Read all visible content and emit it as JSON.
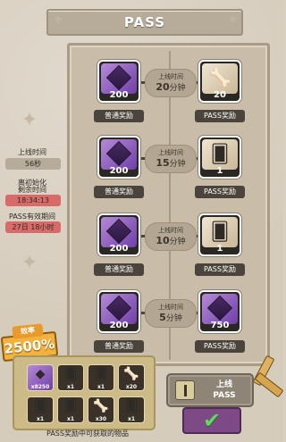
{
  "header": {
    "title": "PASS"
  },
  "rows": [
    {
      "left": {
        "amount": "200",
        "label": "普通奖励"
      },
      "time_top": "上线时间",
      "time_num": "20",
      "time_unit": "分钟",
      "right": {
        "amount": "20",
        "label": "PASS奖励",
        "icon": "bone-key-icon"
      }
    },
    {
      "left": {
        "amount": "200",
        "label": "普通奖励"
      },
      "time_top": "上线时间",
      "time_num": "15",
      "time_unit": "分钟",
      "right": {
        "amount": "1",
        "label": "PASS奖励",
        "icon": "card-icon"
      }
    },
    {
      "left": {
        "amount": "200",
        "label": "普通奖励"
      },
      "time_top": "上线时间",
      "time_num": "10",
      "time_unit": "分钟",
      "right": {
        "amount": "1",
        "label": "PASS奖励",
        "icon": "card-icon"
      }
    },
    {
      "left": {
        "amount": "200",
        "label": "普通奖励"
      },
      "time_top": "上线时间",
      "time_num": "5",
      "time_unit": "分钟",
      "right": {
        "amount": "750",
        "label": "PASS奖励",
        "icon": "purple-gem-icon"
      }
    }
  ],
  "info": {
    "online_label": "上线时间",
    "online_value": "56秒",
    "reset_label_1": "离初始化",
    "reset_label_2": "剩余时间",
    "reset_value": "18:34:13",
    "valid_label": "PASS有效期间",
    "valid_value": "27日 18小时"
  },
  "efficiency": {
    "label": "效率",
    "value": "2500%"
  },
  "tray": {
    "items": [
      {
        "amount": "x8250",
        "icon": "purple-gem-icon"
      },
      {
        "amount": "x1",
        "icon": "card-icon"
      },
      {
        "amount": "x1",
        "icon": "card-icon"
      },
      {
        "amount": "x20",
        "icon": "bone-key-icon"
      },
      {
        "amount": "x1",
        "icon": "card-icon"
      },
      {
        "amount": "x1",
        "icon": "card-icon"
      },
      {
        "amount": "x30",
        "icon": "bone-key-icon"
      },
      {
        "amount": "x1",
        "icon": "card-icon"
      }
    ],
    "caption": "PASS奖励中可获取的物品"
  },
  "claim": {
    "line1": "上线",
    "line2": "PASS"
  }
}
